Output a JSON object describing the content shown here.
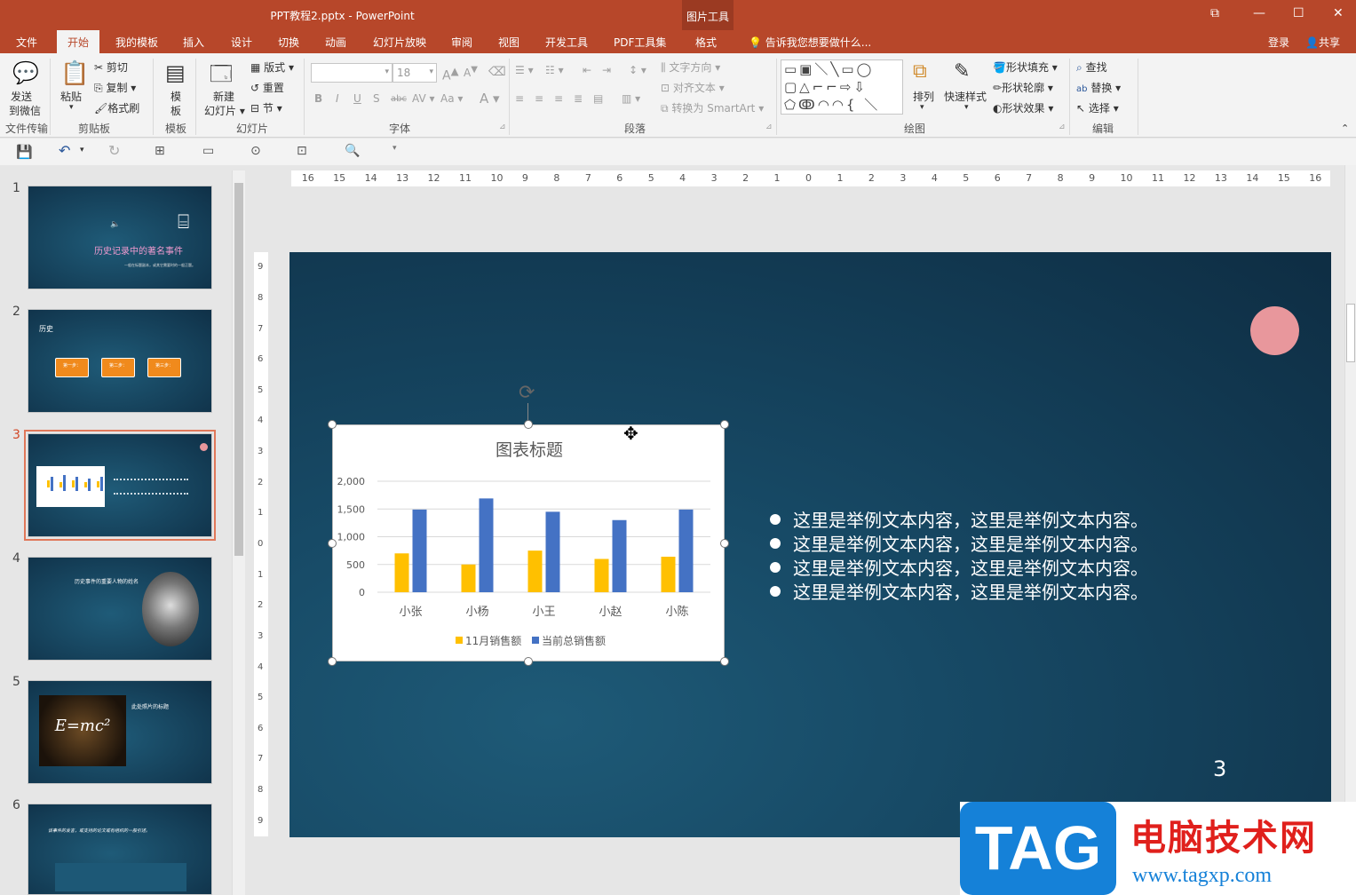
{
  "window": {
    "title": "PPT教程2.pptx - PowerPoint",
    "context_tab_group": "图片工具",
    "login": "登录",
    "share": "共享",
    "search_hint": "告诉我您想要做什么..."
  },
  "tabs": [
    "文件",
    "开始",
    "我的模板",
    "插入",
    "设计",
    "切换",
    "动画",
    "幻灯片放映",
    "审阅",
    "视图",
    "开发工具",
    "PDF工具集",
    "格式"
  ],
  "active_tab": "开始",
  "ribbon": {
    "send_wechat": [
      "发送",
      "到微信"
    ],
    "group_file": "文件传输",
    "paste": "粘贴",
    "cut": "剪切",
    "copy": "复制",
    "format_painter": "格式刷",
    "group_clipboard": "剪贴板",
    "template": [
      "模",
      "板"
    ],
    "group_template": "模板",
    "new_slide": [
      "新建",
      "幻灯片"
    ],
    "layout": "版式",
    "reset": "重置",
    "section": "节",
    "group_slides": "幻灯片",
    "font_size": "18",
    "group_font": "字体",
    "text_direction": "文字方向",
    "align_text": "对齐文本",
    "smartart": "转换为 SmartArt",
    "group_paragraph": "段落",
    "arrange": "排列",
    "quick_styles": "快速样式",
    "shape_fill": "形状填充",
    "shape_outline": "形状轮廓",
    "shape_effects": "形状效果",
    "group_drawing": "绘图",
    "find": "查找",
    "replace": "替换",
    "select": "选择",
    "group_editing": "编辑"
  },
  "ruler_h": [
    "16",
    "15",
    "14",
    "13",
    "12",
    "11",
    "10",
    "9",
    "8",
    "7",
    "6",
    "5",
    "4",
    "3",
    "2",
    "1",
    "0",
    "1",
    "2",
    "3",
    "4",
    "5",
    "6",
    "7",
    "8",
    "9",
    "10",
    "11",
    "12",
    "13",
    "14",
    "15",
    "16"
  ],
  "ruler_v": [
    "9",
    "8",
    "7",
    "6",
    "5",
    "4",
    "3",
    "2",
    "1",
    "0",
    "1",
    "2",
    "3",
    "4",
    "5",
    "6",
    "7",
    "8",
    "9"
  ],
  "slides": [
    {
      "num": "1",
      "title": "历史记录中的著名事件",
      "sub": "一般在标题副本，或其它需要时的一般正题。"
    },
    {
      "num": "2",
      "title": "历史",
      "steps": [
        "第一步：",
        "第二步：",
        "第三步："
      ]
    },
    {
      "num": "3"
    },
    {
      "num": "4",
      "title": "历史事件的重要人物的姓名"
    },
    {
      "num": "5",
      "title": "此处照片的标题",
      "formula": "E=mc²"
    },
    {
      "num": "6",
      "title": "该事件的发言，或支持的论文或有组织的一般引述。"
    }
  ],
  "current_slide": {
    "page_number": "3",
    "bullets": [
      "这里是举例文本内容，这里是举例文本内容。",
      "这里是举例文本内容，这里是举例文本内容。",
      "这里是举例文本内容，这里是举例文本内容。",
      "这里是举例文本内容，这里是举例文本内容。"
    ]
  },
  "chart_data": {
    "type": "bar",
    "title": "图表标题",
    "categories": [
      "小张",
      "小杨",
      "小王",
      "小赵",
      "小陈"
    ],
    "series": [
      {
        "name": "11月销售额",
        "values": [
          700,
          500,
          750,
          600,
          640
        ],
        "color": "#ffc000"
      },
      {
        "name": "当前总销售额",
        "values": [
          1490,
          1690,
          1450,
          1300,
          1490
        ],
        "color": "#4472c4"
      }
    ],
    "ylim": [
      0,
      2000
    ],
    "yticks": [
      "0",
      "500",
      "1,000",
      "1,500",
      "2,000"
    ],
    "grid": true,
    "legend": "bottom"
  },
  "watermark": {
    "brand": "TAG",
    "site_name": "电脑技术网",
    "url": "www.tagxp.com"
  },
  "colors": {
    "accent": "#b7472a",
    "selected_thumb": "#d24726",
    "pink_circle": "#e8979c"
  }
}
